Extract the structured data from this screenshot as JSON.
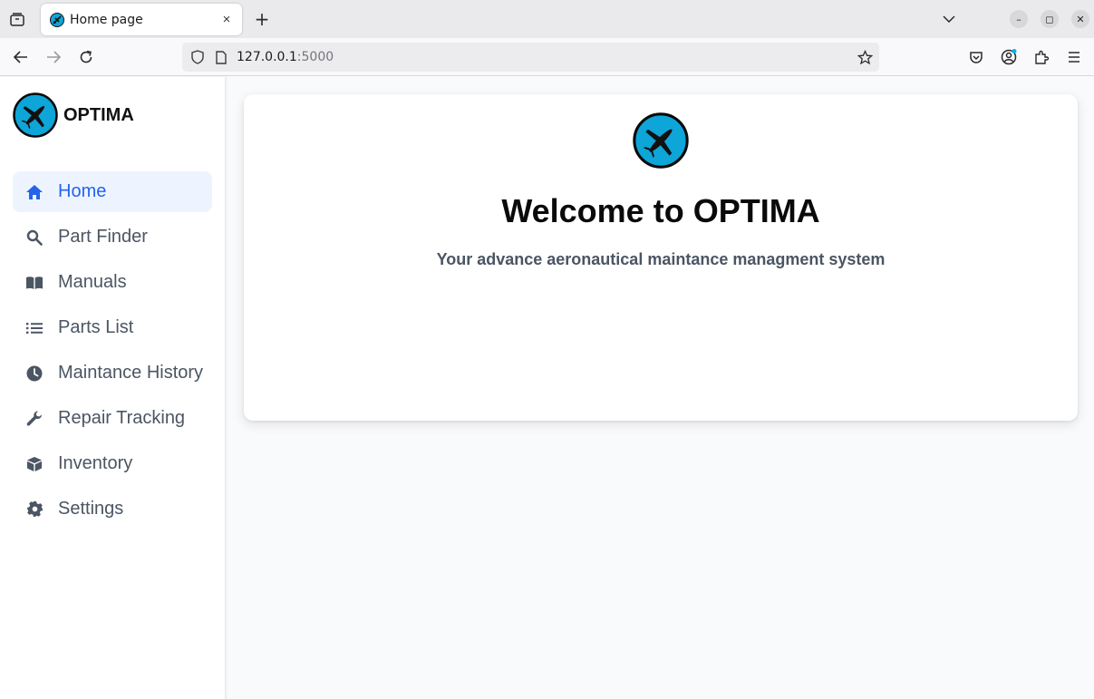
{
  "browser": {
    "tab_title": "Home page",
    "tab_close": "×",
    "new_tab": "+",
    "url_host": "127.0.0.1",
    "url_port": ":5000",
    "window_minimize": "–",
    "window_restore": "◻",
    "window_close": "✕"
  },
  "brand": {
    "name": "OPTIMA",
    "logo_color": "#0ea5d8"
  },
  "sidebar": {
    "items": [
      {
        "label": "Home",
        "icon": "home-icon",
        "active": true
      },
      {
        "label": "Part Finder",
        "icon": "search-icon",
        "active": false
      },
      {
        "label": "Manuals",
        "icon": "book-icon",
        "active": false
      },
      {
        "label": "Parts List",
        "icon": "list-icon",
        "active": false
      },
      {
        "label": "Maintance History",
        "icon": "clock-icon",
        "active": false
      },
      {
        "label": "Repair Tracking",
        "icon": "wrench-icon",
        "active": false
      },
      {
        "label": "Inventory",
        "icon": "box-icon",
        "active": false
      },
      {
        "label": "Settings",
        "icon": "gear-icon",
        "active": false
      }
    ]
  },
  "main": {
    "title": "Welcome to OPTIMA",
    "subtitle": "Your advance aeronautical maintance managment system"
  },
  "colors": {
    "accent": "#2563eb",
    "active_bg": "#eef4ff",
    "text_muted": "#4b5563"
  }
}
